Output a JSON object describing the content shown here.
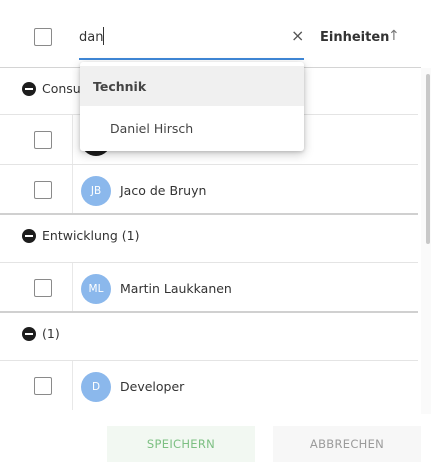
{
  "header": {
    "search_value": "dan",
    "clear_glyph": "×",
    "sort_label": "Einheiten",
    "sort_glyph": "↑"
  },
  "dropdown": {
    "group_label": "Technik",
    "options": [
      {
        "label": "Daniel Hirsch"
      }
    ]
  },
  "groups": [
    {
      "label": "Consu",
      "members": [
        {
          "initials": "",
          "name": ""
        },
        {
          "initials": "JB",
          "name": "Jaco de Bruyn"
        }
      ]
    },
    {
      "label": "Entwicklung (1)",
      "members": [
        {
          "initials": "ML",
          "name": "Martin Laukkanen"
        }
      ]
    },
    {
      "label": "(1)",
      "members": [
        {
          "initials": "D",
          "name": "Developer"
        }
      ]
    }
  ],
  "footer": {
    "save_label": "SPEICHERN",
    "cancel_label": "ABBRECHEN"
  },
  "colors": {
    "accent": "#3f88d8",
    "avatar": "#8bb8ec",
    "save_text": "#7cbf82"
  }
}
